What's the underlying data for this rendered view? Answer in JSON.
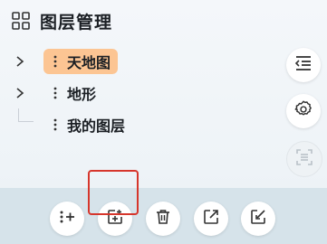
{
  "panel": {
    "title": "图层管理",
    "title_icon": "grid-icon"
  },
  "tree": {
    "items": [
      {
        "label": "天地图",
        "expandable": true,
        "selected": true
      },
      {
        "label": "地形",
        "expandable": true,
        "selected": false
      },
      {
        "label": "我的图层",
        "expandable": false,
        "selected": false
      }
    ]
  },
  "side_tools": [
    {
      "icon": "list-indent-icon",
      "enabled": true
    },
    {
      "icon": "gear-icon",
      "enabled": true
    },
    {
      "icon": "scan-icon",
      "enabled": false
    }
  ],
  "bottom_toolbar": [
    {
      "icon": "add-group-icon"
    },
    {
      "icon": "add-layer-icon",
      "highlighted": true
    },
    {
      "icon": "trash-icon"
    },
    {
      "icon": "export-icon"
    },
    {
      "icon": "edit-icon"
    }
  ],
  "colors": {
    "selected_bg": "#fcc593",
    "highlight": "#d6362c",
    "toolbar_bg": "#d6e3ea"
  }
}
